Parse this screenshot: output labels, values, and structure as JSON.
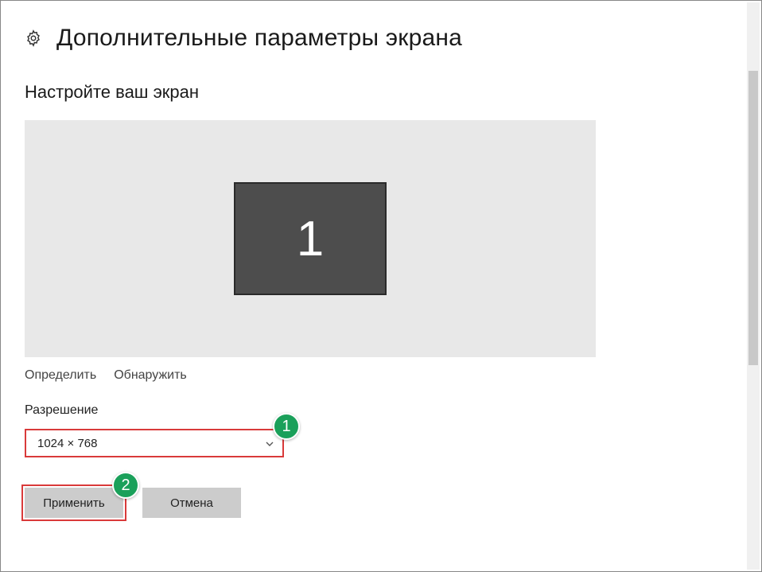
{
  "header": {
    "title": "Дополнительные параметры экрана"
  },
  "subtitle": "Настройте ваш экран",
  "monitor": {
    "number": "1"
  },
  "links": {
    "identify": "Определить",
    "detect": "Обнаружить"
  },
  "resolution": {
    "label": "Разрешение",
    "value": "1024 × 768"
  },
  "buttons": {
    "apply": "Применить",
    "cancel": "Отмена"
  },
  "callouts": {
    "one": "1",
    "two": "2"
  }
}
